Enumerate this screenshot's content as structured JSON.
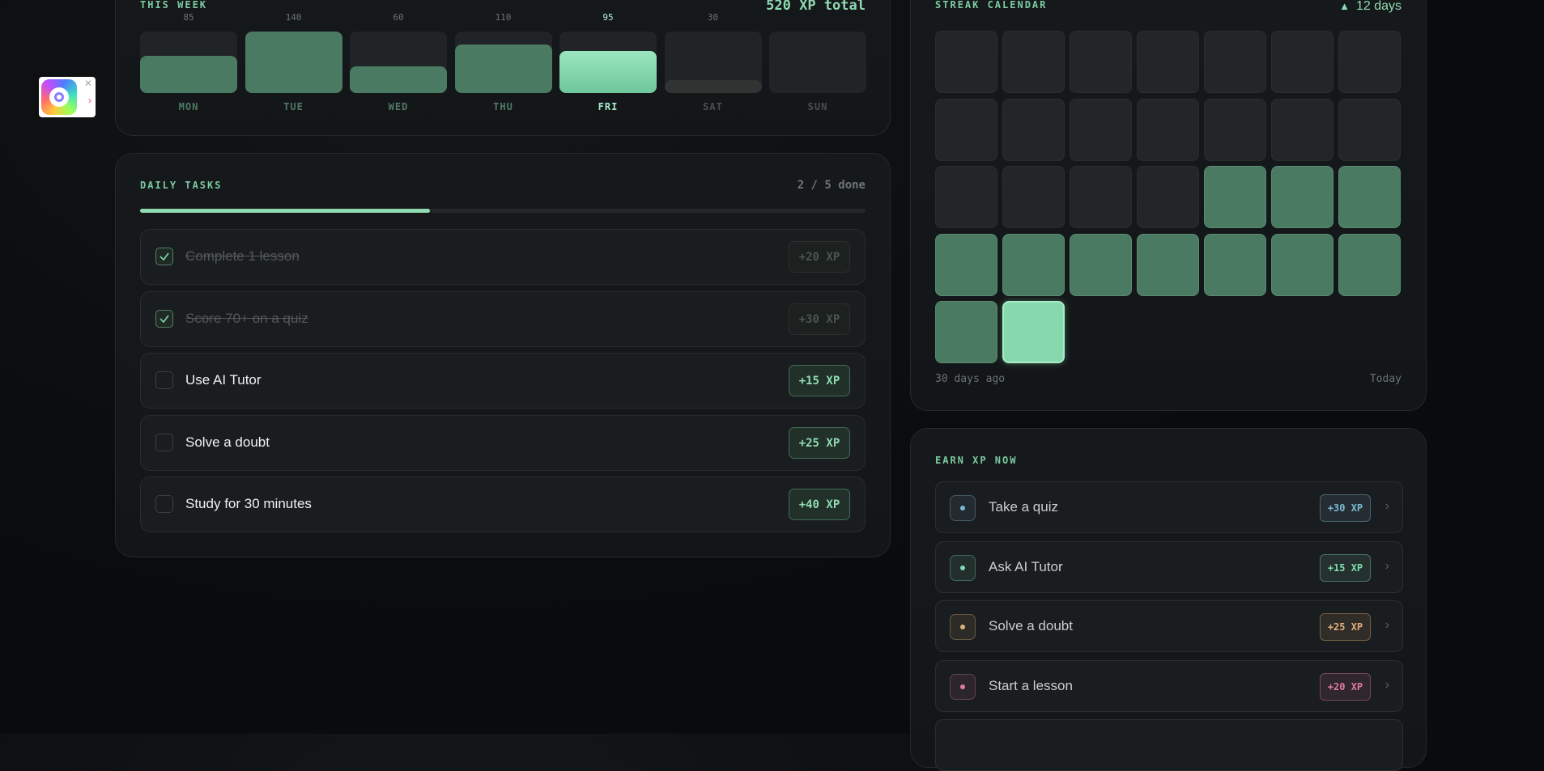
{
  "week": {
    "label": "THIS WEEK",
    "total": "520 XP total",
    "days": [
      {
        "name": "MON",
        "value": "85",
        "fraction": 0.61
      },
      {
        "name": "TUE",
        "value": "140",
        "fraction": 1.0
      },
      {
        "name": "WED",
        "value": "60",
        "fraction": 0.43
      },
      {
        "name": "THU",
        "value": "110",
        "fraction": 0.79
      },
      {
        "name": "FRI",
        "value": "95",
        "fraction": 0.68,
        "active": true
      },
      {
        "name": "SAT",
        "value": "30",
        "fraction": 0.21
      },
      {
        "name": "SUN",
        "value": "",
        "fraction": 0
      }
    ]
  },
  "tasks": {
    "label": "DAILY TASKS",
    "done_text": "2 / 5 done",
    "progress": 0.4,
    "items": [
      {
        "label": "Complete 1 lesson",
        "xp": "+20 XP",
        "done": true
      },
      {
        "label": "Score 70+ on a quiz",
        "xp": "+30 XP",
        "done": true
      },
      {
        "label": "Use AI Tutor",
        "xp": "+15 XP",
        "done": false
      },
      {
        "label": "Solve a doubt",
        "xp": "+25 XP",
        "done": false
      },
      {
        "label": "Study for 30 minutes",
        "xp": "+40 XP",
        "done": false
      }
    ]
  },
  "streak": {
    "label": "STREAK CALENDAR",
    "days_text": "12 days",
    "flame_icon": "flame-icon",
    "start_label": "30 days ago",
    "end_label": "Today",
    "cells": [
      0,
      0,
      0,
      0,
      0,
      0,
      0,
      0,
      0,
      0,
      0,
      0,
      0,
      0,
      0,
      0,
      0,
      0,
      1,
      1,
      1,
      1,
      1,
      1,
      1,
      1,
      1,
      1,
      1,
      2
    ]
  },
  "earn": {
    "label": "EARN XP NOW",
    "items": [
      {
        "label": "Take a quiz",
        "xp": "+30 XP",
        "color": "#7fb8d6",
        "icon": "quiz-icon"
      },
      {
        "label": "Ask AI Tutor",
        "xp": "+15 XP",
        "color": "#7fdcae",
        "icon": "tutor-icon"
      },
      {
        "label": "Solve a doubt",
        "xp": "+25 XP",
        "color": "#e0b07a",
        "icon": "doubt-icon"
      },
      {
        "label": "Start a lesson",
        "xp": "+20 XP",
        "color": "#e07aa0",
        "icon": "lesson-icon"
      }
    ]
  }
}
